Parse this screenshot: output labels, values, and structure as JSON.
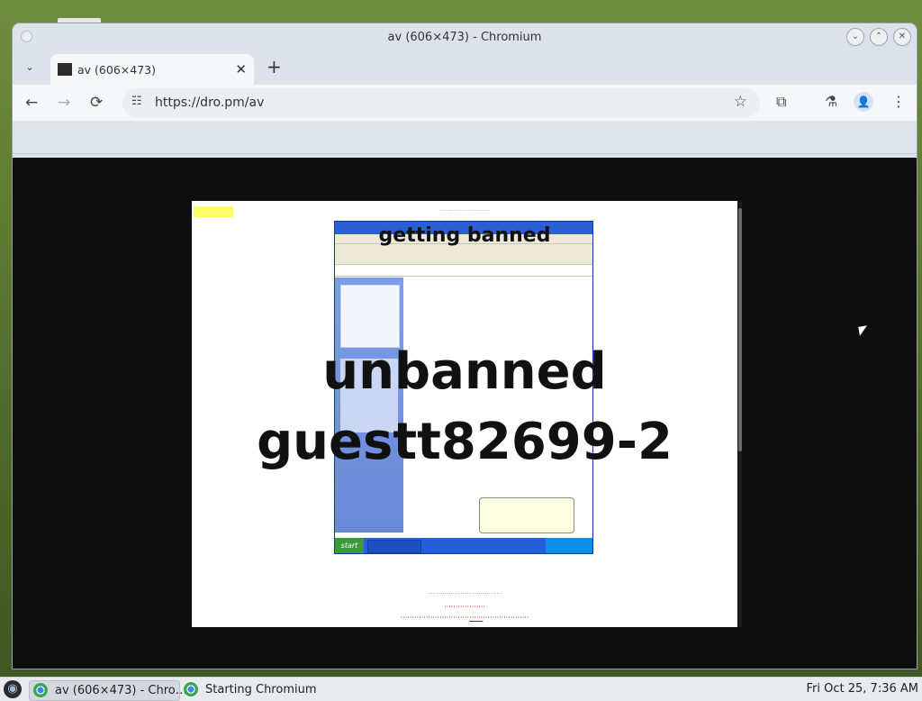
{
  "window": {
    "title": "av (606×473) - Chromium",
    "controls": {
      "minimize": "⌄",
      "maximize": "⌃",
      "close": "✕"
    }
  },
  "tabs": [
    {
      "label": "av (606×473)",
      "close": "✕"
    }
  ],
  "toolbar": {
    "url": "https://dro.pm/av",
    "back_icon": "←",
    "forward_icon": "→",
    "reload_icon": "⟳",
    "site_info_icon": "☷",
    "star_icon": "☆",
    "extensions_icon": "⧉",
    "labs_icon": "⚗",
    "profile_icon": "👤",
    "menu_icon": "⋮",
    "newtab_icon": "+",
    "tabsearch_icon": "⌄"
  },
  "page": {
    "overlay_top": "getting banned",
    "overlay_line1": "unbanned",
    "overlay_line2": "guestt82699-2",
    "xp_start": "start"
  },
  "taskbar": {
    "items": [
      {
        "label": "av (606×473) - Chro…"
      },
      {
        "label": "Starting Chromium"
      }
    ],
    "clock": "Fri Oct 25,  7:36 AM"
  },
  "colors": {
    "desktop_green": "#5a7a33",
    "viewport_black": "#0e0e0e",
    "xp_blue": "#245edb",
    "profile_blue": "#1a73e8"
  }
}
